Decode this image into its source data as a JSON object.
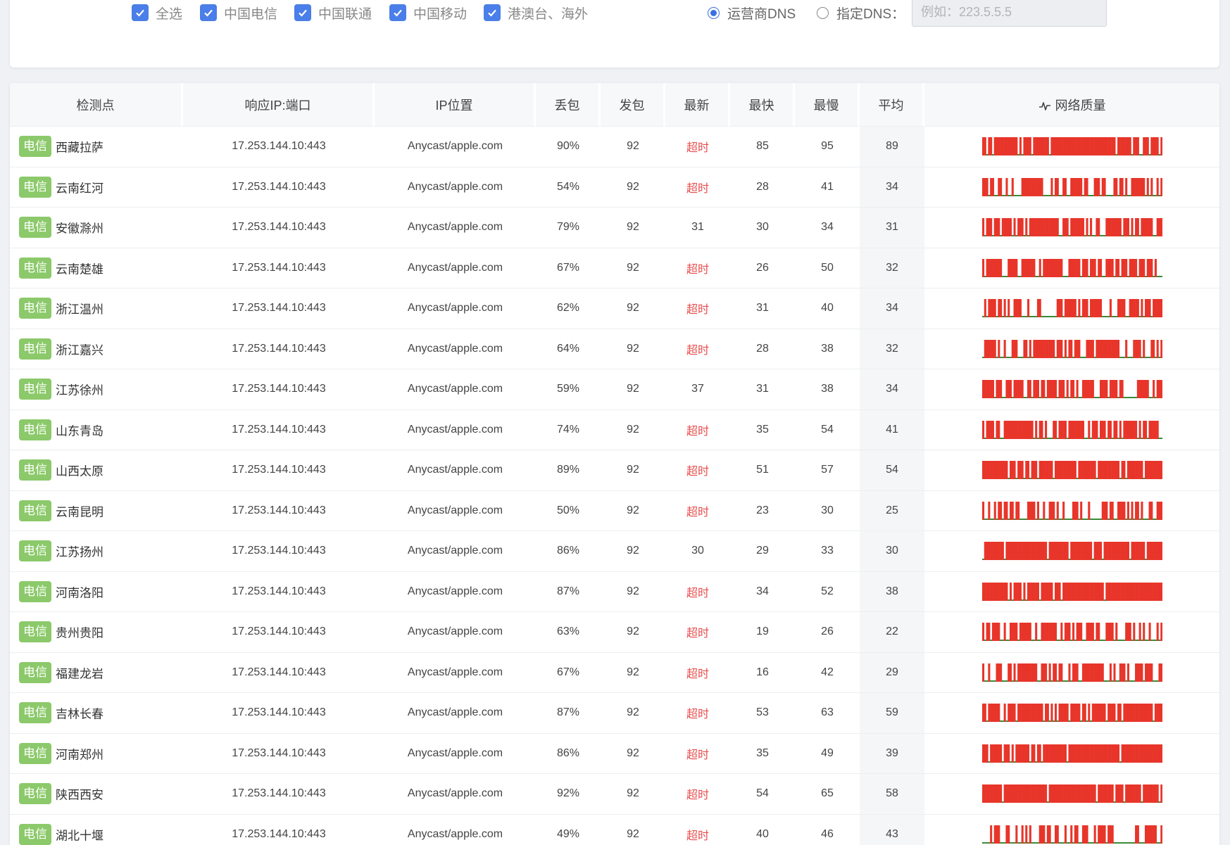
{
  "filters": {
    "checkboxes": [
      {
        "label": "全选",
        "checked": true
      },
      {
        "label": "中国电信",
        "checked": true
      },
      {
        "label": "中国联通",
        "checked": true
      },
      {
        "label": "中国移动",
        "checked": true
      },
      {
        "label": "港澳台、海外",
        "checked": true
      }
    ],
    "dns_options": [
      {
        "label": "运营商DNS",
        "selected": true
      },
      {
        "label": "指定DNS：",
        "selected": false
      }
    ],
    "dns_input_placeholder": "例如：223.5.5.5"
  },
  "table": {
    "headers": [
      "检测点",
      "响应IP:端口",
      "IP位置",
      "丢包",
      "发包",
      "最新",
      "最快",
      "最慢",
      "平均",
      "网络质量"
    ],
    "colors": {
      "loss": "#e8352a",
      "ok": "#3a8a3a",
      "isp_tag": "#8bc96a",
      "timeout_text": "#e84c4c"
    },
    "rows": [
      {
        "isp": "电信",
        "location": "西藏拉萨",
        "ip": "17.253.144.10:443",
        "ip_location": "Anycast/apple.com",
        "loss": "90%",
        "sent": "92",
        "latest": "超时",
        "fastest": "85",
        "slowest": "95",
        "avg": "89"
      },
      {
        "isp": "电信",
        "location": "云南红河",
        "ip": "17.253.144.10:443",
        "ip_location": "Anycast/apple.com",
        "loss": "54%",
        "sent": "92",
        "latest": "超时",
        "fastest": "28",
        "slowest": "41",
        "avg": "34"
      },
      {
        "isp": "电信",
        "location": "安徽滁州",
        "ip": "17.253.144.10:443",
        "ip_location": "Anycast/apple.com",
        "loss": "79%",
        "sent": "92",
        "latest": "31",
        "fastest": "30",
        "slowest": "34",
        "avg": "31"
      },
      {
        "isp": "电信",
        "location": "云南楚雄",
        "ip": "17.253.144.10:443",
        "ip_location": "Anycast/apple.com",
        "loss": "67%",
        "sent": "92",
        "latest": "超时",
        "fastest": "26",
        "slowest": "50",
        "avg": "32"
      },
      {
        "isp": "电信",
        "location": "浙江温州",
        "ip": "17.253.144.10:443",
        "ip_location": "Anycast/apple.com",
        "loss": "62%",
        "sent": "92",
        "latest": "超时",
        "fastest": "31",
        "slowest": "40",
        "avg": "34"
      },
      {
        "isp": "电信",
        "location": "浙江嘉兴",
        "ip": "17.253.144.10:443",
        "ip_location": "Anycast/apple.com",
        "loss": "64%",
        "sent": "92",
        "latest": "超时",
        "fastest": "28",
        "slowest": "38",
        "avg": "32"
      },
      {
        "isp": "电信",
        "location": "江苏徐州",
        "ip": "17.253.144.10:443",
        "ip_location": "Anycast/apple.com",
        "loss": "59%",
        "sent": "92",
        "latest": "37",
        "fastest": "31",
        "slowest": "38",
        "avg": "34"
      },
      {
        "isp": "电信",
        "location": "山东青岛",
        "ip": "17.253.144.10:443",
        "ip_location": "Anycast/apple.com",
        "loss": "74%",
        "sent": "92",
        "latest": "超时",
        "fastest": "35",
        "slowest": "54",
        "avg": "41"
      },
      {
        "isp": "电信",
        "location": "山西太原",
        "ip": "17.253.144.10:443",
        "ip_location": "Anycast/apple.com",
        "loss": "89%",
        "sent": "92",
        "latest": "超时",
        "fastest": "51",
        "slowest": "57",
        "avg": "54"
      },
      {
        "isp": "电信",
        "location": "云南昆明",
        "ip": "17.253.144.10:443",
        "ip_location": "Anycast/apple.com",
        "loss": "50%",
        "sent": "92",
        "latest": "超时",
        "fastest": "23",
        "slowest": "30",
        "avg": "25"
      },
      {
        "isp": "电信",
        "location": "江苏扬州",
        "ip": "17.253.144.10:443",
        "ip_location": "Anycast/apple.com",
        "loss": "86%",
        "sent": "92",
        "latest": "30",
        "fastest": "29",
        "slowest": "33",
        "avg": "30"
      },
      {
        "isp": "电信",
        "location": "河南洛阳",
        "ip": "17.253.144.10:443",
        "ip_location": "Anycast/apple.com",
        "loss": "87%",
        "sent": "92",
        "latest": "超时",
        "fastest": "34",
        "slowest": "52",
        "avg": "38"
      },
      {
        "isp": "电信",
        "location": "贵州贵阳",
        "ip": "17.253.144.10:443",
        "ip_location": "Anycast/apple.com",
        "loss": "63%",
        "sent": "92",
        "latest": "超时",
        "fastest": "19",
        "slowest": "26",
        "avg": "22"
      },
      {
        "isp": "电信",
        "location": "福建龙岩",
        "ip": "17.253.144.10:443",
        "ip_location": "Anycast/apple.com",
        "loss": "67%",
        "sent": "92",
        "latest": "超时",
        "fastest": "16",
        "slowest": "42",
        "avg": "29"
      },
      {
        "isp": "电信",
        "location": "吉林长春",
        "ip": "17.253.144.10:443",
        "ip_location": "Anycast/apple.com",
        "loss": "87%",
        "sent": "92",
        "latest": "超时",
        "fastest": "53",
        "slowest": "63",
        "avg": "59"
      },
      {
        "isp": "电信",
        "location": "河南郑州",
        "ip": "17.253.144.10:443",
        "ip_location": "Anycast/apple.com",
        "loss": "86%",
        "sent": "92",
        "latest": "超时",
        "fastest": "35",
        "slowest": "49",
        "avg": "39"
      },
      {
        "isp": "电信",
        "location": "陕西西安",
        "ip": "17.253.144.10:443",
        "ip_location": "Anycast/apple.com",
        "loss": "92%",
        "sent": "92",
        "latest": "超时",
        "fastest": "54",
        "slowest": "65",
        "avg": "58"
      },
      {
        "isp": "电信",
        "location": "湖北十堰",
        "ip": "17.253.144.10:443",
        "ip_location": "Anycast/apple.com",
        "loss": "49%",
        "sent": "92",
        "latest": "超时",
        "fastest": "40",
        "slowest": "46",
        "avg": "43"
      }
    ]
  }
}
